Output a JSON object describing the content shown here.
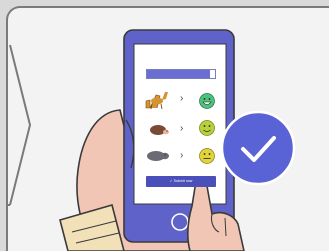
{
  "survey": {
    "progress_fraction": 0.92,
    "submit_label": "✓  Submit now"
  },
  "rows": [
    {
      "animal_icon": "giraffe-icon",
      "arrow": "›",
      "face_icon": "grinning-face-icon",
      "face_color": "#4cc27a"
    },
    {
      "animal_icon": "hedgehog-icon",
      "arrow": "›",
      "face_icon": "smiling-face-icon",
      "face_color": "#b6d23a"
    },
    {
      "animal_icon": "hippo-icon",
      "arrow": "›",
      "face_icon": "neutral-face-icon",
      "face_color": "#e0d43a"
    }
  ],
  "colors": {
    "phone_body": "#5f63c9",
    "accent": "#4b4fb9",
    "badge": "#5a63d6",
    "skin": "#f2c6b5"
  },
  "badge_icon": "checkmark-icon"
}
